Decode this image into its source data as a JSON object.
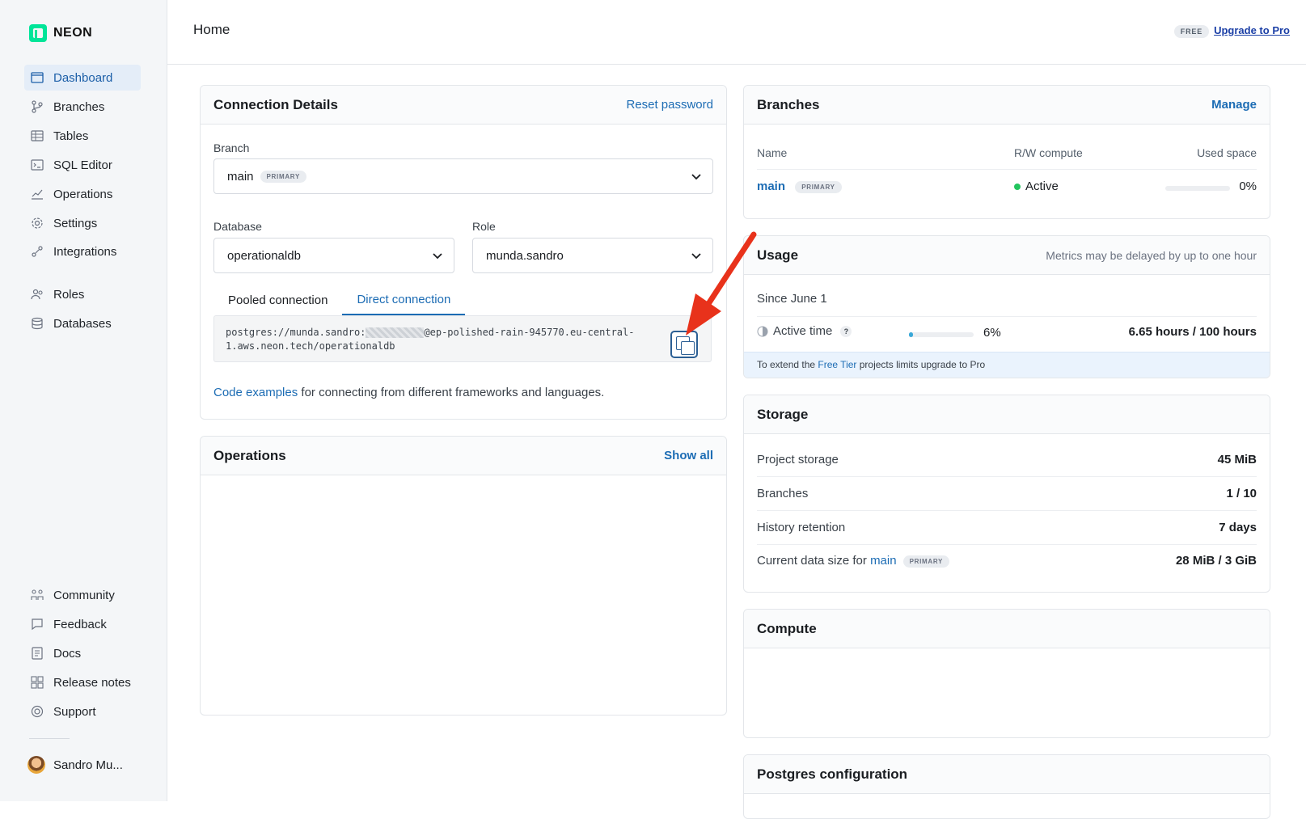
{
  "brand": {
    "name": "NEON"
  },
  "sidebar": {
    "items": [
      {
        "label": "Dashboard",
        "icon": "dashboard-icon"
      },
      {
        "label": "Branches",
        "icon": "branch-icon"
      },
      {
        "label": "Tables",
        "icon": "table-icon"
      },
      {
        "label": "SQL Editor",
        "icon": "sql-editor-icon"
      },
      {
        "label": "Operations",
        "icon": "operations-icon"
      },
      {
        "label": "Settings",
        "icon": "gear-icon"
      },
      {
        "label": "Integrations",
        "icon": "integrations-icon"
      },
      {
        "label": "Roles",
        "icon": "users-icon"
      },
      {
        "label": "Databases",
        "icon": "database-icon"
      }
    ],
    "bottom_items": [
      {
        "label": "Community",
        "icon": "community-icon"
      },
      {
        "label": "Feedback",
        "icon": "chat-icon"
      },
      {
        "label": "Docs",
        "icon": "docs-icon"
      },
      {
        "label": "Release notes",
        "icon": "grid-icon"
      },
      {
        "label": "Support",
        "icon": "lifebuoy-icon"
      }
    ],
    "user_name": "Sandro Mu..."
  },
  "header": {
    "title": "Home",
    "plan": "FREE",
    "upgrade_label": "Upgrade to Pro"
  },
  "connection": {
    "title": "Connection Details",
    "reset_label": "Reset password",
    "branch_label": "Branch",
    "branch_value": "main",
    "branch_badge": "PRIMARY",
    "database_label": "Database",
    "database_value": "operationaldb",
    "role_label": "Role",
    "role_value": "munda.sandro",
    "tab_pooled": "Pooled connection",
    "tab_direct": "Direct connection",
    "conn_prefix": "postgres://munda.sandro:",
    "conn_suffix": "@ep-polished-rain-945770.eu-central-",
    "conn_line2": "1.aws.neon.tech/operationaldb",
    "code_link": "Code examples",
    "code_text": " for connecting from different frameworks and languages."
  },
  "operations": {
    "title": "Operations",
    "show_all": "Show all"
  },
  "branches": {
    "title": "Branches",
    "manage": "Manage",
    "columns": [
      "Name",
      "R/W compute",
      "Used space"
    ],
    "row": {
      "name": "main",
      "badge": "PRIMARY",
      "status": "Active",
      "used": "0%",
      "used_fraction": 0.0
    },
    "status_color": "#22c55e"
  },
  "usage": {
    "title": "Usage",
    "note": "Metrics may be delayed by up to one hour",
    "since": "Since June 1",
    "active_label": "Active time",
    "help": "?",
    "percent": "6%",
    "percent_fraction": 0.06,
    "hours": "6.65 hours / 100 hours",
    "banner_pre": "To extend the ",
    "banner_link": "Free Tier",
    "banner_post": " projects limits upgrade to Pro"
  },
  "storage": {
    "title": "Storage",
    "rows": [
      {
        "label": "Project storage",
        "value": "45 MiB"
      },
      {
        "label": "Branches",
        "value": "1 / 10"
      },
      {
        "label": "History retention",
        "value": "7 days"
      }
    ],
    "current_label": "Current data size for ",
    "current_branch": "main",
    "current_badge": "PRIMARY",
    "current_value": "28 MiB / 3 GiB"
  },
  "compute": {
    "title": "Compute"
  },
  "postgres": {
    "title": "Postgres configuration"
  },
  "accent_color": "#1c6cb4",
  "annotation_color": "#e8321b"
}
